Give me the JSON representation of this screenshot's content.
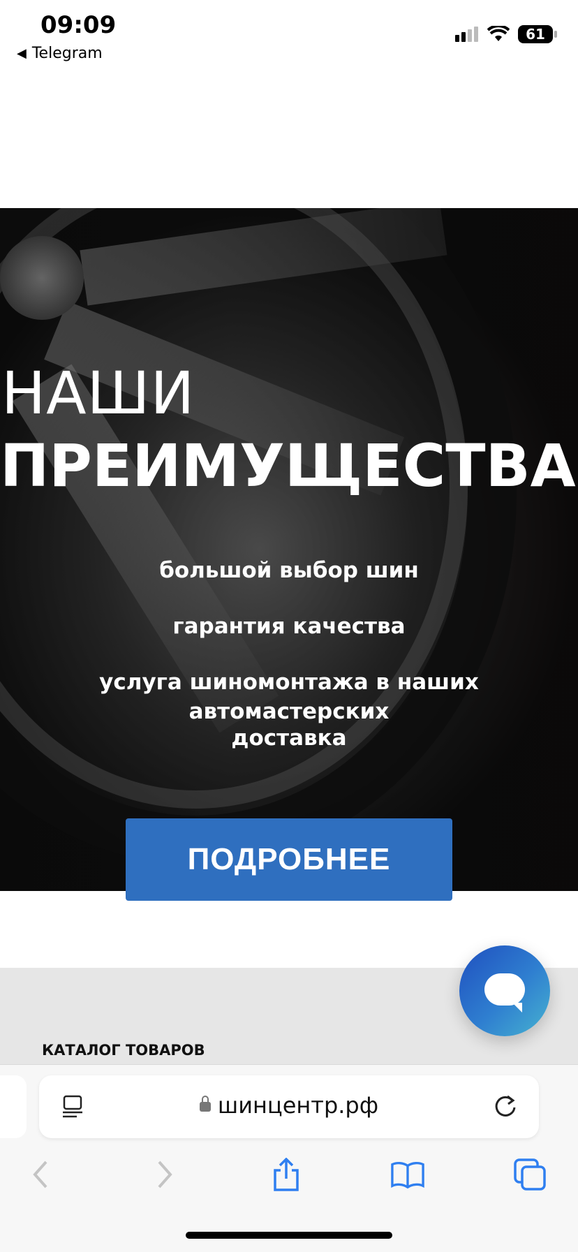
{
  "status_bar": {
    "time": "09:09",
    "back_app": "Telegram",
    "battery": "61"
  },
  "hero": {
    "title_line1": "НАШИ",
    "title_line2": "ПРЕИМУЩЕСТВА",
    "benefits": [
      "большой выбор шин",
      "гарантия качества",
      "услуга шиномонтажа в наших автомастерских",
      "доставка"
    ],
    "button_label": "ПОДРОБНЕЕ"
  },
  "section": {
    "catalog_label": "КАТАЛОГ ТОВАРОВ"
  },
  "browser": {
    "url": "шинцентр.рф"
  },
  "colors": {
    "button_blue": "#2f6fbf",
    "toolbar_icon": "#2f7ff0"
  },
  "icons": [
    "back-arrow-icon",
    "signal-icon",
    "wifi-icon",
    "battery-icon",
    "chat-icon",
    "reader-icon",
    "lock-icon",
    "reload-icon",
    "back-icon",
    "forward-icon",
    "share-icon",
    "bookmarks-icon",
    "tabs-icon"
  ]
}
